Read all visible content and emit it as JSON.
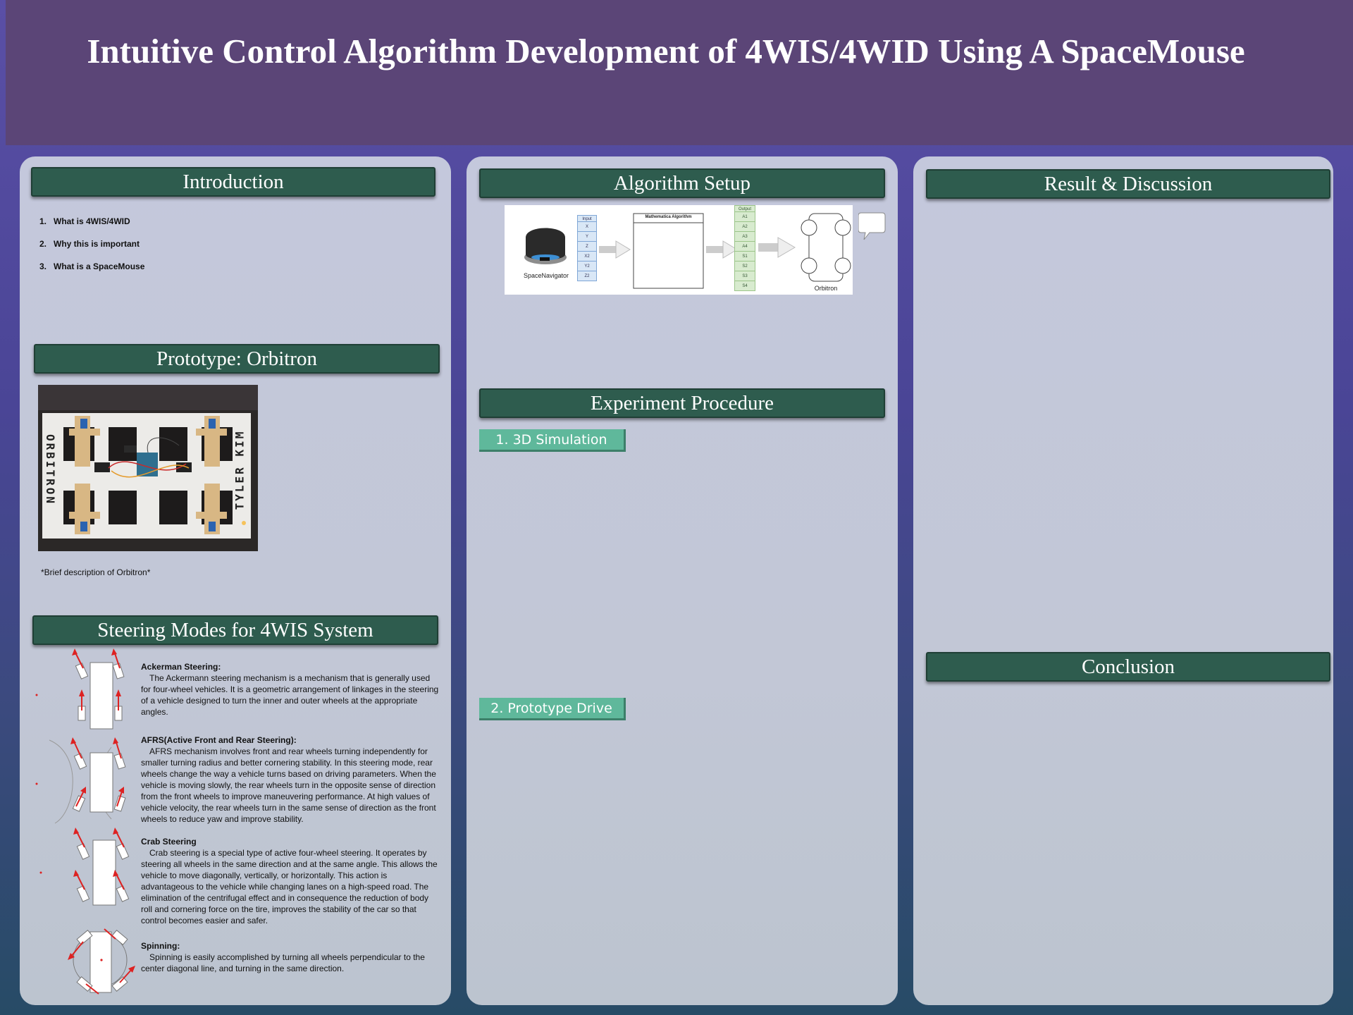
{
  "poster": {
    "title": "Intuitive Control Algorithm Development of 4WIS/4WID Using A SpaceMouse"
  },
  "introduction": {
    "heading": "Introduction",
    "items": [
      {
        "num": "1.",
        "text": "What is 4WIS/4WID"
      },
      {
        "num": "2.",
        "text": "Why this is important"
      },
      {
        "num": "3.",
        "text": "What is a SpaceMouse"
      }
    ]
  },
  "prototype": {
    "heading": "Prototype: Orbitron",
    "photo_label_left": "ORBITRON",
    "photo_label_right": "TYLER KIM",
    "caption": "*Brief description of Orbitron*"
  },
  "steering": {
    "heading": "Steering Modes for 4WIS System",
    "modes": [
      {
        "title": "Ackerman Steering:",
        "body": "The Ackermann steering mechanism is a mechanism that is generally used for four-wheel vehicles. It is a geometric arrangement of linkages in the steering of a vehicle designed to turn the inner and outer wheels at the appropriate angles."
      },
      {
        "title": "AFRS(Active Front and Rear Steering):",
        "body": "AFRS mechanism involves front and rear wheels turning independently for smaller turning radius and better cornering stability. In this steering mode, rear wheels change the way a vehicle turns based on driving parameters. When the vehicle is moving slowly, the rear wheels turn in the opposite sense of direction from the front wheels to improve maneuvering performance. At high values of vehicle velocity, the rear wheels turn in the same sense of direction as the front wheels to reduce yaw and improve stability."
      },
      {
        "title": "Crab Steering",
        "body": "Crab steering is a special type of active four-wheel steering. It operates by steering all wheels in the same direction and at the same angle. This allows the vehicle to move diagonally, vertically, or horizontally. This action is advantageous to the vehicle while changing lanes on a high-speed road. The elimination of the centrifugal effect and in consequence the reduction of body roll and cornering force on the tire, improves the stability of the car so that control becomes easier and safer."
      },
      {
        "title": "Spinning:",
        "body": "Spinning is easily accomplished by turning all wheels perpendicular to the center diagonal line, and turning in the same direction."
      }
    ]
  },
  "algorithm": {
    "heading": "Algorithm Setup",
    "device_label": "SpaceNavigator",
    "input_header": "Input",
    "inputs": [
      "X",
      "Y",
      "Z",
      "X2",
      "Y2",
      "Z2"
    ],
    "algorithm_label": "Mathematica Algorithm",
    "output_header": "Output",
    "outputs": [
      "A1",
      "A2",
      "A3",
      "A4",
      "S1",
      "S2",
      "S3",
      "S4"
    ],
    "robot_label": "Orbitron"
  },
  "experiment": {
    "heading": "Experiment Procedure",
    "step1": "1. 3D Simulation",
    "step2": "2. Prototype Drive"
  },
  "results": {
    "heading": "Result & Discussion"
  },
  "conclusion": {
    "heading": "Conclusion"
  },
  "colors": {
    "title_band": "#5b4577",
    "header_green": "#2e5c4e",
    "sub_green": "#5fb89b",
    "panel": "#c4c8dc"
  }
}
